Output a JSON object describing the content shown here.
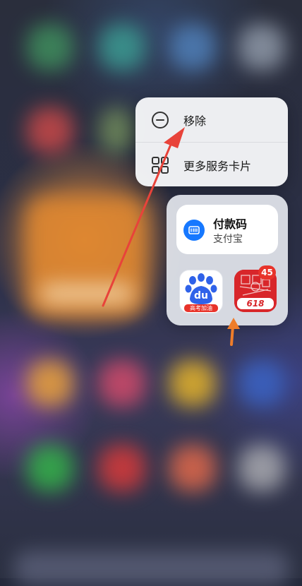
{
  "context_menu": {
    "items": [
      {
        "label": "移除",
        "icon": "minus-circle-icon"
      },
      {
        "label": "更多服务卡片",
        "icon": "grid-icon"
      }
    ]
  },
  "widget": {
    "card_title": "付款码",
    "card_subtitle": "支付宝",
    "card_icon": "alipay-icon",
    "apps": [
      {
        "icon": "baidu-icon",
        "brand_text": "du",
        "caption": "高考加油"
      },
      {
        "icon": "jd-618-icon",
        "brand_text": "618",
        "badge": "45"
      }
    ]
  },
  "colors": {
    "annotation_arrow": "#e8433a",
    "highlight_arrow": "#ef7d2a",
    "accent_blue": "#1678ff"
  }
}
